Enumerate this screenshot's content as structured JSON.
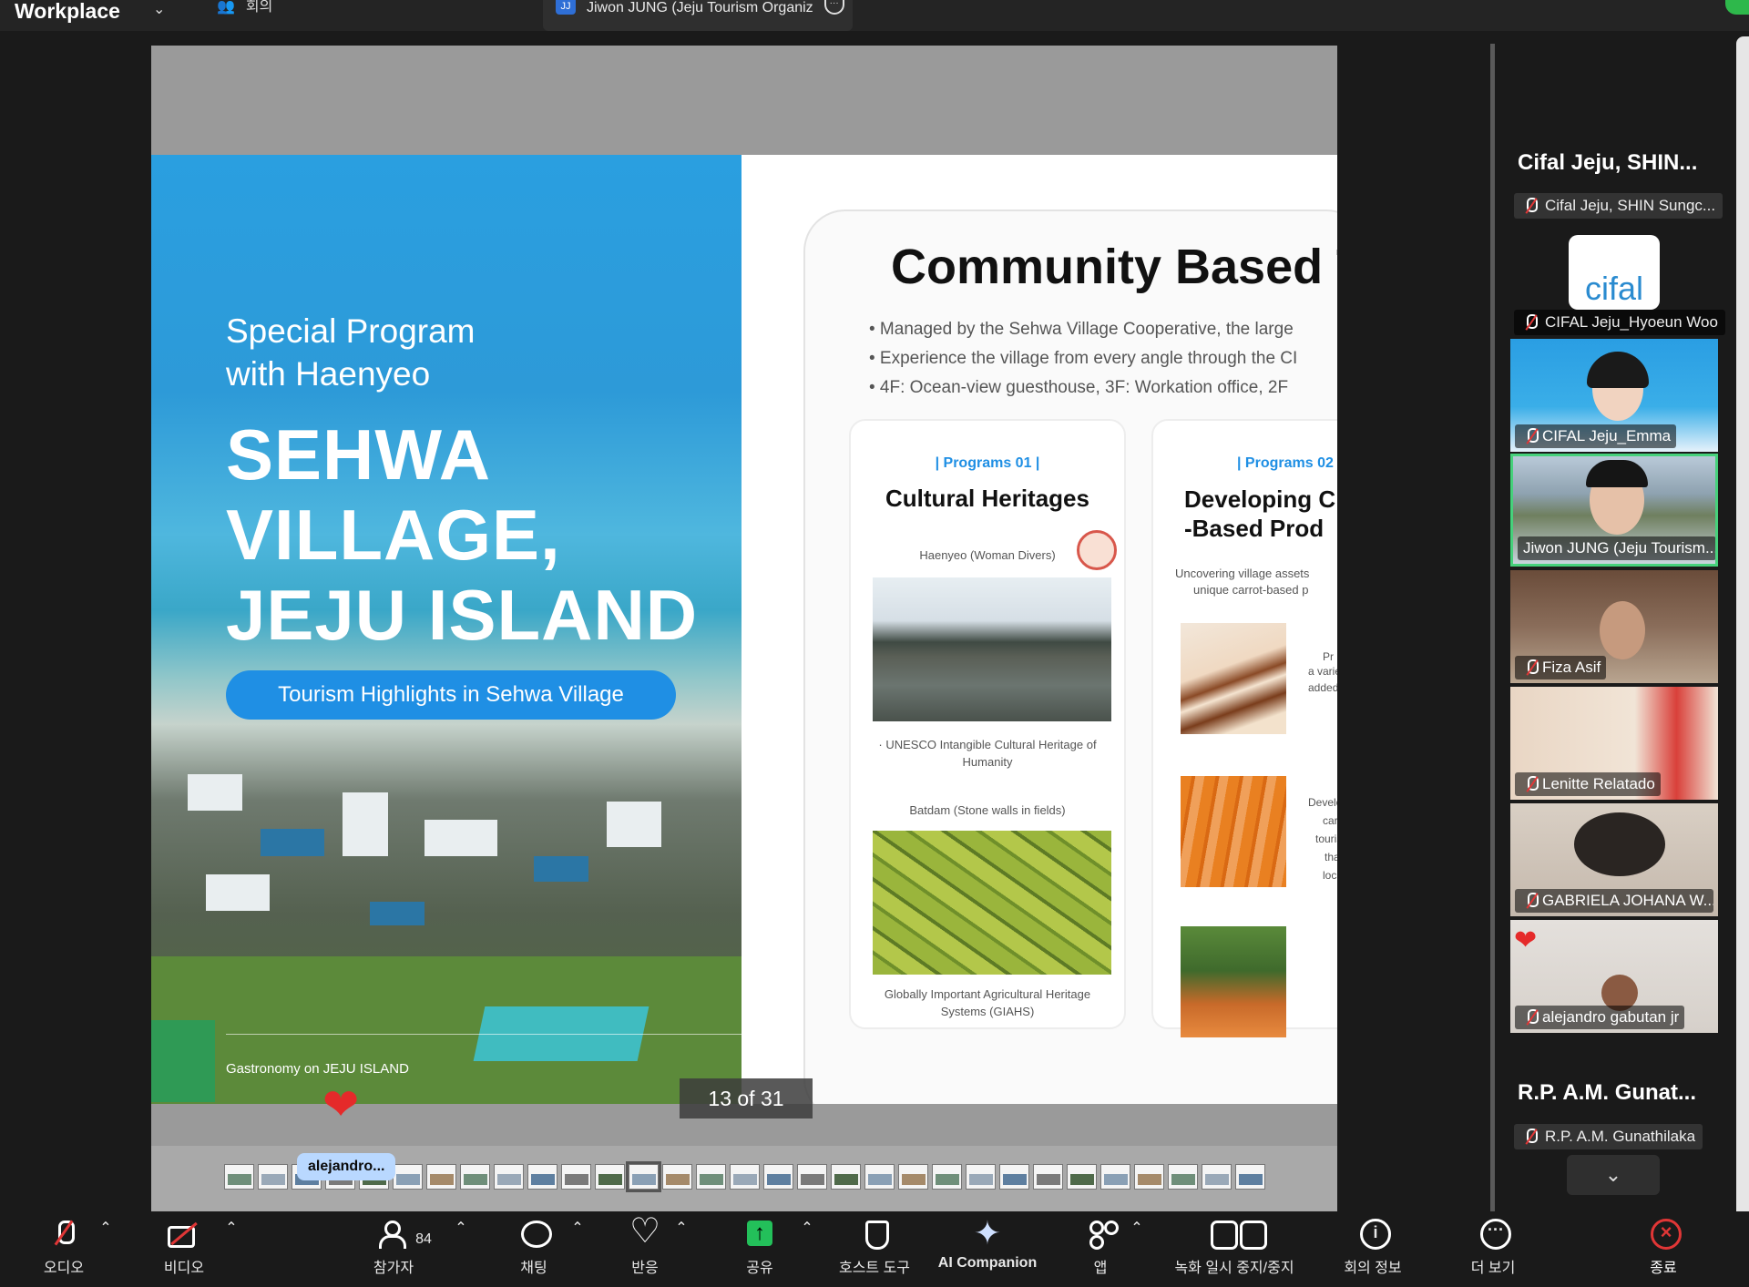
{
  "topbar": {
    "brand": "Workplace",
    "meeting_label": "회의",
    "share_tab_initials": "JJ",
    "share_tab_title": "Jiwon JUNG (Jeju Tourism Organiz"
  },
  "slide": {
    "subtitle_line1": "Special Program",
    "subtitle_line2": "with Haenyeo",
    "title_line1": "SEHWA",
    "title_line2": "VILLAGE,",
    "title_line3": "JEJU ISLAND",
    "pill": "Tourism Highlights in Sehwa Village",
    "footer": "Gastronomy on JEJU ISLAND",
    "right_title": "Community Based T",
    "bullets": [
      "• Managed by the Sehwa Village Cooperative, the large",
      "• Experience the village from every angle through the CI",
      "• 4F: Ocean-view guesthouse, 3F: Workation office, 2F"
    ],
    "card1": {
      "tag": "| Programs 01 |",
      "title": "Cultural Heritages",
      "cap1": "Haenyeo (Woman Divers)",
      "cap2": "· UNESCO Intangible Cultural Heritage of Humanity",
      "cap3": "Batdam (Stone walls in fields)",
      "cap4": "Globally Important Agricultural Heritage Systems (GIAHS)"
    },
    "card2": {
      "tag": "| Programs 02",
      "title_line1": "Developing C",
      "title_line2": "-Based Prod",
      "cap1": "Uncovering village assets",
      "cap2": "unique carrot-based p",
      "side1": "Pr",
      "side2": "a varie",
      "side3": "added",
      "side4": "Develop",
      "side5": "carr",
      "side6": "tourism",
      "side7": "tha",
      "side8": "loca"
    },
    "page_counter": "13 of 31"
  },
  "thumb_name_tag": "alejandro...",
  "panel": {
    "heading1": "Cifal Jeju, SHIN...",
    "tag1": "Cifal Jeju, SHIN Sungc...",
    "logo_text": "cifal",
    "tile1_label": "CIFAL Jeju_Hyoeun Woo",
    "tile2_label": "CIFAL Jeju_Emma",
    "tile3_label": "Jiwon JUNG (Jeju Tourism...",
    "tile4_label": "Fiza Asif",
    "tile5_label": "Lenitte Relatado",
    "tile6_label": "GABRIELA JOHANA W...",
    "tile7_label": "alejandro gabutan jr",
    "heading2": "R.P. A.M. Gunat...",
    "tag2": "R.P. A.M. Gunathilaka",
    "more_chevron": "⌄"
  },
  "toolbar": {
    "audio": "오디오",
    "video": "비디오",
    "participants": "참가자",
    "participants_count": "84",
    "chat": "채팅",
    "reactions": "반응",
    "share": "공유",
    "host_tools": "호스트 도구",
    "ai_companion": "AI Companion",
    "apps": "앱",
    "recording": "녹화 일시 중지/중지",
    "meeting_info": "회의 정보",
    "more": "더 보기",
    "end": "종료",
    "caret": "⌃"
  }
}
